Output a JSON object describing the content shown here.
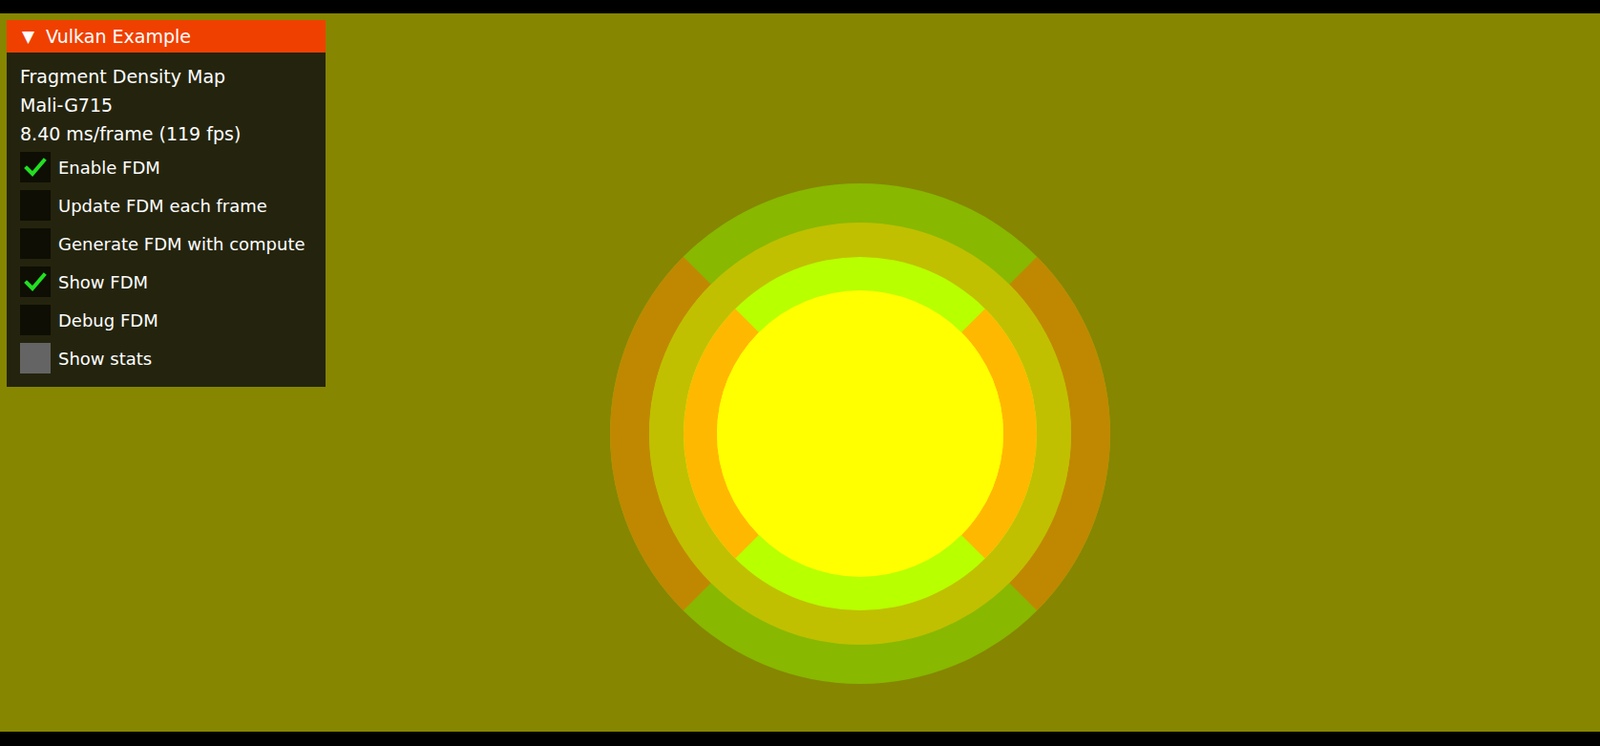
{
  "window": {
    "title": "Vulkan Example",
    "expand_icon": "▼",
    "expanded": true
  },
  "info": [
    "Fragment Density Map",
    "Mali-G715",
    "8.40 ms/frame (119 fps)"
  ],
  "options": [
    {
      "label": "Enable FDM",
      "checked": true,
      "hovered": false
    },
    {
      "label": "Update FDM each frame",
      "checked": false,
      "hovered": false
    },
    {
      "label": "Generate FDM with compute",
      "checked": false,
      "hovered": false
    },
    {
      "label": "Show FDM",
      "checked": true,
      "hovered": false
    },
    {
      "label": "Debug FDM",
      "checked": false,
      "hovered": false
    },
    {
      "label": "Show stats",
      "checked": false,
      "hovered": true
    }
  ],
  "density_map": {
    "rings": [
      {
        "color": "#88b800",
        "side_color": "#c08800"
      },
      {
        "color": "#c0c000",
        "side_color": "#c0c000"
      },
      {
        "color": "#b8ff00",
        "side_color": "#ffb800"
      },
      {
        "color": "#ffff00",
        "side_color": "#ffff00"
      }
    ]
  }
}
